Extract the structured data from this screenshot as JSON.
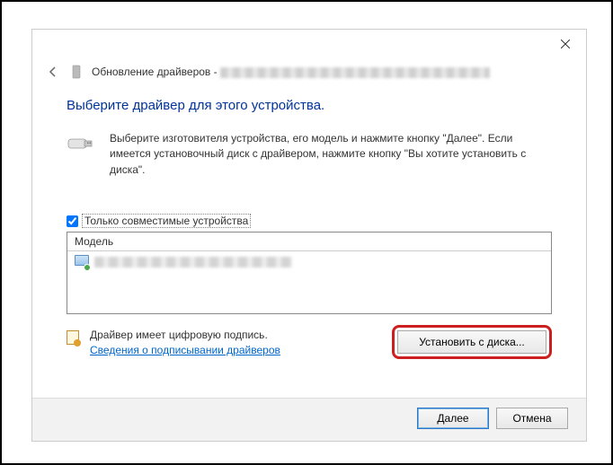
{
  "titlebar": {
    "close": "✕"
  },
  "header": {
    "title": "Обновление драйверов - "
  },
  "main": {
    "heading": "Выберите драйвер для этого устройства.",
    "instruction": "Выберите изготовителя устройства, его модель и нажмите кнопку \"Далее\". Если имеется установочный диск с драйвером, нажмите кнопку \"Вы хотите установить с диска\"."
  },
  "checkbox": {
    "label": "Только совместимые устройства",
    "checked": true
  },
  "list": {
    "header": "Модель"
  },
  "signature": {
    "text": "Драйвер имеет цифровую подпись.",
    "link": "Сведения о подписывании драйверов"
  },
  "buttons": {
    "fromDisk": "Установить с диска...",
    "next": "Далее",
    "cancel": "Отмена"
  }
}
